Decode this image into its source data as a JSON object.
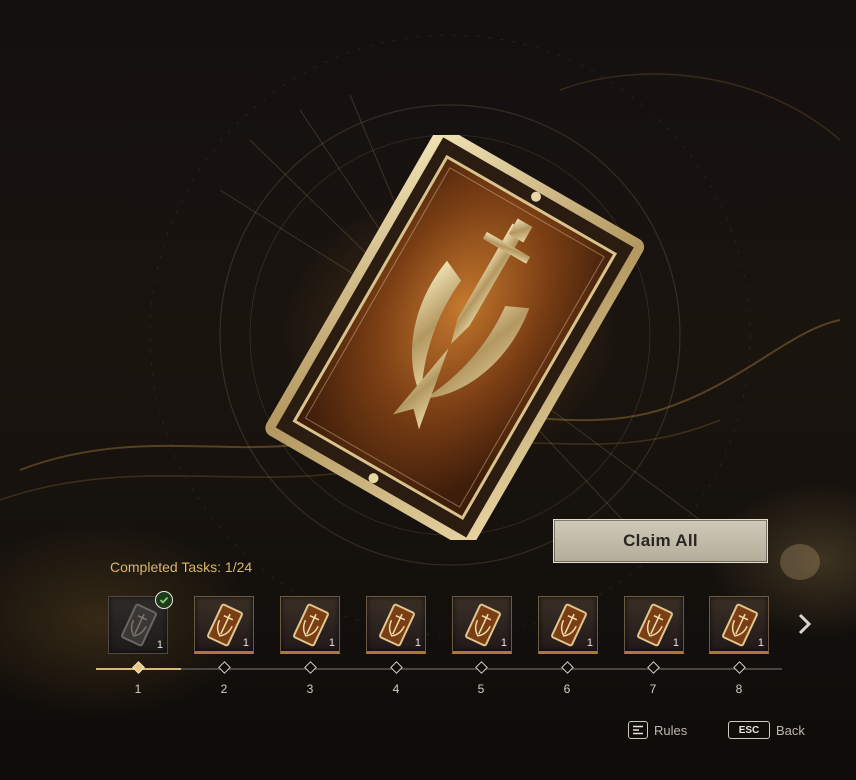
{
  "screen": {
    "title": ""
  },
  "hero": {
    "icon": "sword-crest-shield-icon"
  },
  "claim": {
    "label": "Claim All"
  },
  "progress": {
    "label": "Completed Tasks: 1/24",
    "completed": 1,
    "total": 24
  },
  "rewards": [
    {
      "node": "1",
      "qty": "1",
      "claimed": true
    },
    {
      "node": "2",
      "qty": "1",
      "claimed": false
    },
    {
      "node": "3",
      "qty": "1",
      "claimed": false
    },
    {
      "node": "4",
      "qty": "1",
      "claimed": false
    },
    {
      "node": "5",
      "qty": "1",
      "claimed": false
    },
    {
      "node": "6",
      "qty": "1",
      "claimed": false
    },
    {
      "node": "7",
      "qty": "1",
      "claimed": false
    },
    {
      "node": "8",
      "qty": "1",
      "claimed": false
    }
  ],
  "footer": {
    "rules": {
      "key": "",
      "label": "Rules",
      "icon": "list-icon"
    },
    "back": {
      "key": "ESC",
      "label": "Back"
    }
  },
  "colors": {
    "accent": "#d9b66a",
    "gold": "#c89a52",
    "button_bg": "#c7c1ae"
  }
}
